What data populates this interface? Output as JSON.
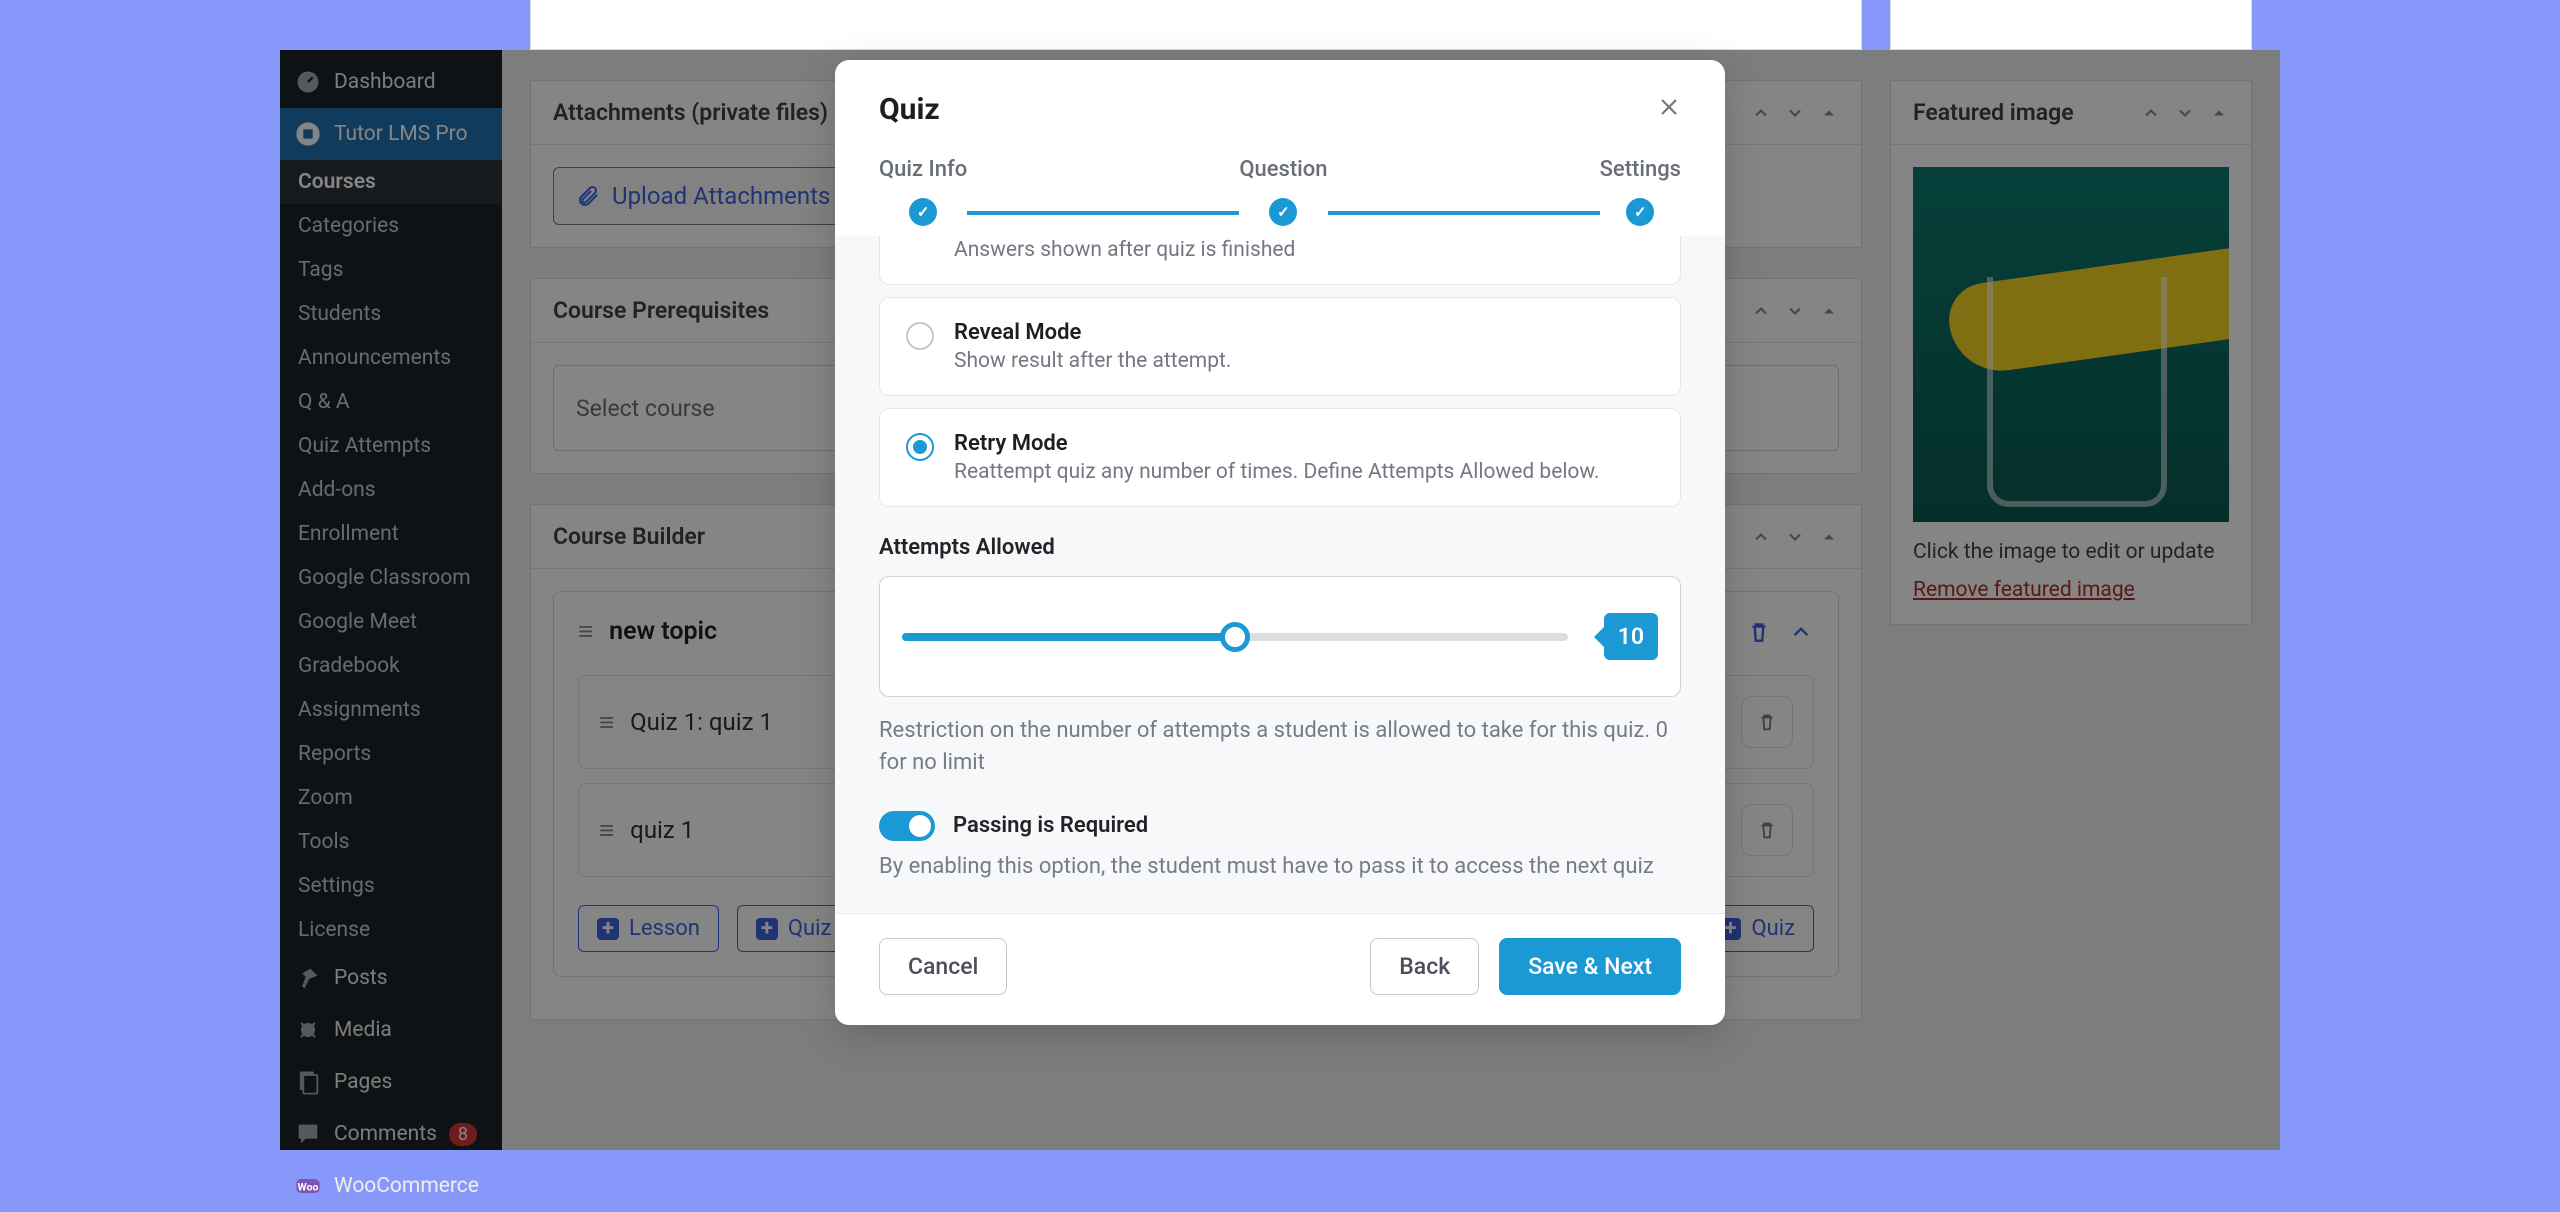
{
  "sidebar": {
    "dashboard": "Dashboard",
    "tutor": "Tutor LMS Pro",
    "submenu": [
      "Courses",
      "Categories",
      "Tags",
      "Students",
      "Announcements",
      "Q & A",
      "Quiz Attempts",
      "Add-ons",
      "Enrollment",
      "Google Classroom",
      "Google Meet",
      "Gradebook",
      "Assignments",
      "Reports",
      "Zoom",
      "Tools",
      "Settings",
      "License"
    ],
    "posts": "Posts",
    "media": "Media",
    "pages": "Pages",
    "comments": "Comments",
    "comments_badge": "8",
    "woo": "WooCommerce"
  },
  "panels": {
    "attachments": "Attachments (private files)",
    "upload": "Upload Attachments",
    "prereq": "Course Prerequisites",
    "select_course": "Select course",
    "builder": "Course Builder"
  },
  "topic": {
    "name": "new topic",
    "items": [
      "Quiz 1: quiz 1",
      "quiz 1"
    ],
    "add_lesson": "Lesson",
    "add_quiz": "Quiz",
    "add_quiz2": "Quiz"
  },
  "featured": {
    "title": "Featured image",
    "caption": "Click the image to edit or update",
    "remove": "Remove featured image"
  },
  "modal": {
    "title": "Quiz",
    "steps": [
      "Quiz Info",
      "Question",
      "Settings"
    ],
    "reveal_partial": "Answers shown after quiz is finished",
    "reveal_title": "Reveal Mode",
    "reveal_sub": "Show result after the attempt.",
    "retry_title": "Retry Mode",
    "retry_sub": "Reattempt quiz any number of times. Define Attempts Allowed below.",
    "attempts_label": "Attempts Allowed",
    "attempts_value": "10",
    "attempts_help": "Restriction on the number of attempts a student is allowed to take for this quiz. 0 for no limit",
    "passing_label": "Passing is Required",
    "passing_help": "By enabling this option, the student must have to pass it to access the next quiz",
    "cancel": "Cancel",
    "back": "Back",
    "save": "Save & Next"
  }
}
